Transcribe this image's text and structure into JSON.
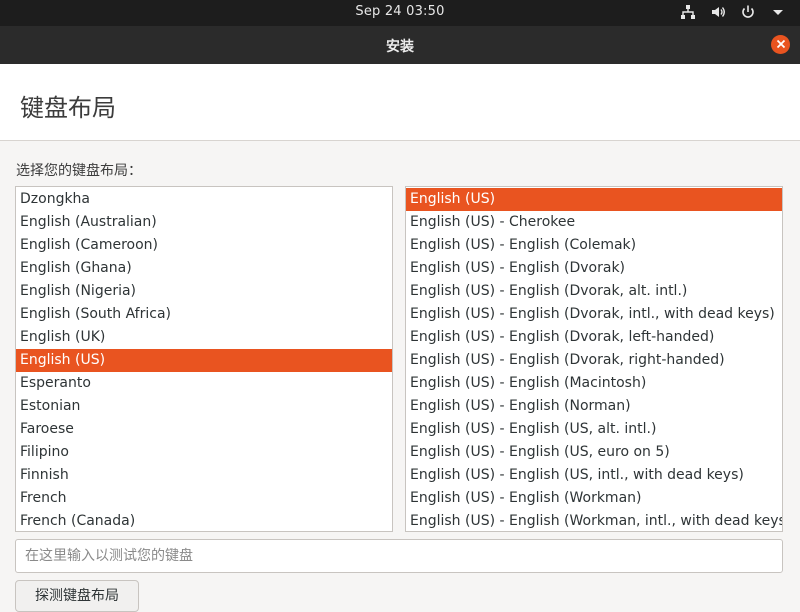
{
  "topbar": {
    "clock": "Sep 24  03:50",
    "icons": [
      "network-icon",
      "volume-icon",
      "power-icon",
      "chevron-down-icon"
    ]
  },
  "window": {
    "title": "安装",
    "close_icon": "close-icon"
  },
  "page": {
    "title": "键盘布局",
    "prompt": "选择您的键盘布局："
  },
  "layouts": [
    "Dzongkha",
    "English (Australian)",
    "English (Cameroon)",
    "English (Ghana)",
    "English (Nigeria)",
    "English (South Africa)",
    "English (UK)",
    "English (US)",
    "Esperanto",
    "Estonian",
    "Faroese",
    "Filipino",
    "Finnish",
    "French",
    "French (Canada)"
  ],
  "selected_layout": "English (US)",
  "variants": [
    "English (US)",
    "English (US) - Cherokee",
    "English (US) - English (Colemak)",
    "English (US) - English (Dvorak)",
    "English (US) - English (Dvorak, alt. intl.)",
    "English (US) - English (Dvorak, intl., with dead keys)",
    "English (US) - English (Dvorak, left-handed)",
    "English (US) - English (Dvorak, right-handed)",
    "English (US) - English (Macintosh)",
    "English (US) - English (Norman)",
    "English (US) - English (US, alt. intl.)",
    "English (US) - English (US, euro on 5)",
    "English (US) - English (US, intl., with dead keys)",
    "English (US) - English (Workman)",
    "English (US) - English (Workman, intl., with dead keys)"
  ],
  "selected_variant": "English (US)",
  "test_input": {
    "value": "",
    "placeholder": "在这里输入以测试您的键盘"
  },
  "detect_button": "探测键盘布局",
  "colors": {
    "accent": "#e95420",
    "topbar": "#1d1d1d",
    "titlebar": "#2b2b2b"
  }
}
